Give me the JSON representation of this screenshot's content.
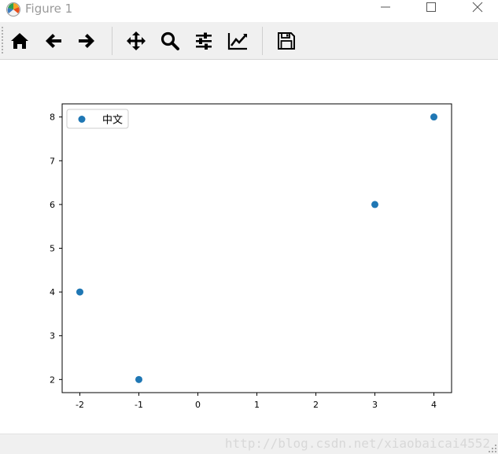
{
  "window": {
    "title": "Figure 1"
  },
  "toolbar": {
    "buttons": [
      {
        "name": "home",
        "icon": "home-icon"
      },
      {
        "name": "back",
        "icon": "arrow-left-icon"
      },
      {
        "name": "forward",
        "icon": "arrow-right-icon"
      },
      {
        "name": "pan",
        "icon": "move-icon"
      },
      {
        "name": "zoom",
        "icon": "magnifier-icon"
      },
      {
        "name": "subplots",
        "icon": "sliders-icon"
      },
      {
        "name": "edit-axes",
        "icon": "chart-line-icon"
      },
      {
        "name": "save",
        "icon": "floppy-disk-icon"
      }
    ]
  },
  "chart_data": {
    "type": "scatter",
    "title": "",
    "xlabel": "",
    "ylabel": "",
    "xlim": [
      -2.3,
      4.3
    ],
    "ylim": [
      1.7,
      8.3
    ],
    "xticks": [
      -2,
      -1,
      0,
      1,
      2,
      3,
      4
    ],
    "xtick_labels": [
      "-2",
      "-1",
      "0",
      "1",
      "2",
      "3",
      "4"
    ],
    "yticks": [
      2,
      3,
      4,
      5,
      6,
      7,
      8
    ],
    "ytick_labels": [
      "2",
      "3",
      "4",
      "5",
      "6",
      "7",
      "8"
    ],
    "grid": false,
    "legend": "top-left",
    "series": [
      {
        "name": "中文",
        "color": "#1f77b4",
        "x": [
          -2,
          -1,
          3,
          4
        ],
        "y": [
          4,
          2,
          6,
          8
        ]
      }
    ]
  },
  "statusbar": {
    "watermark": "http://blog.csdn.net/xiaobaicai4552"
  }
}
